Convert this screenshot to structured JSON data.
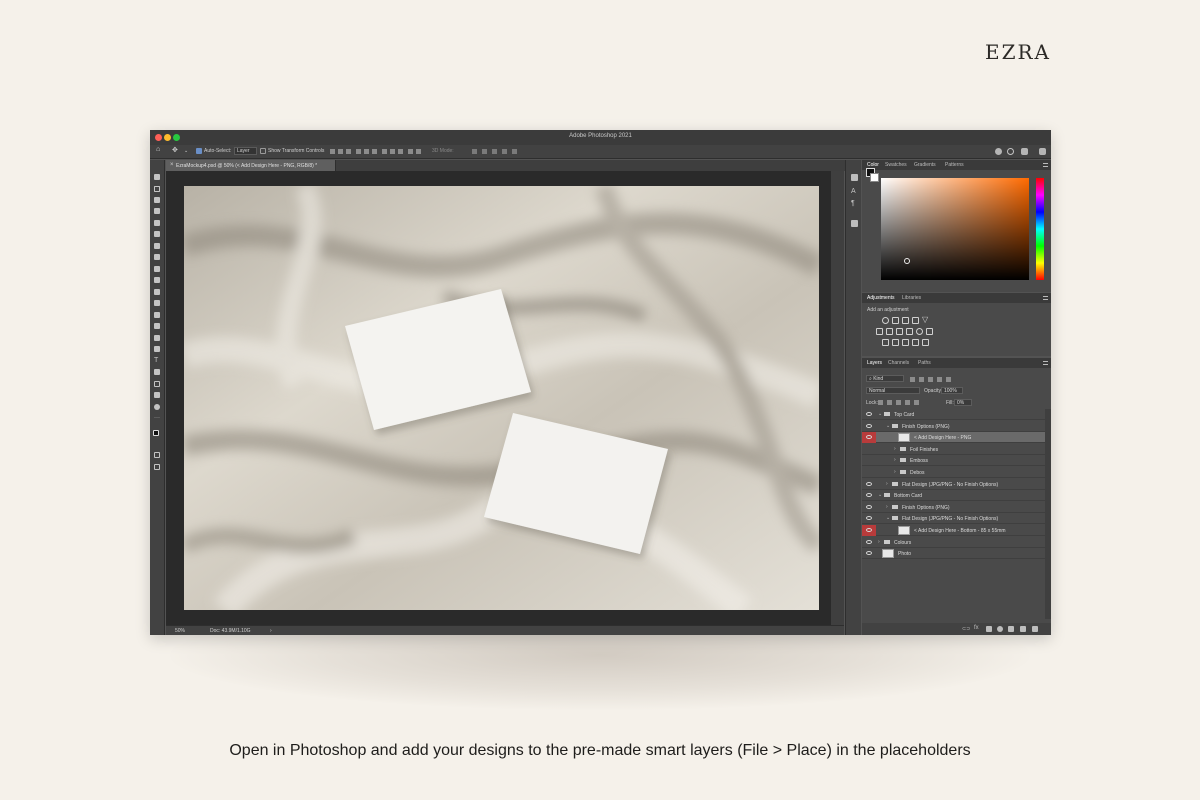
{
  "brand": "EZRA",
  "caption": "Open in Photoshop and add your designs to the pre-made smart layers (File > Place) in the placeholders",
  "app": {
    "window_title": "Adobe Photoshop 2021",
    "options_bar": {
      "auto_select": "Auto-Select:",
      "auto_select_target": "Layer",
      "show_transform": "Show Transform Controls",
      "mode_3d": "3D Mode:"
    },
    "document_tab": "EzraMockup4.psd @ 50% (< Add Design Here - PNG, RGB/8) *",
    "status": {
      "zoom": "50%",
      "doc": "Doc: 43.9M/1.10G"
    },
    "color_panel": {
      "tabs": [
        "Color",
        "Swatches",
        "Gradients",
        "Patterns"
      ]
    },
    "adjustments_panel": {
      "tabs": [
        "Adjustments",
        "Libraries"
      ],
      "hint": "Add an adjustment"
    },
    "layers_panel": {
      "tabs": [
        "Layers",
        "Channels",
        "Paths"
      ],
      "filter": "Kind",
      "blend_mode": "Normal",
      "opacity_label": "Opacity:",
      "opacity_value": "100%",
      "lock_label": "Lock:",
      "fill_label": "Fill:",
      "fill_value": "0%",
      "layers": [
        {
          "name": "Top Card",
          "indent": 0,
          "type": "group",
          "open": true,
          "eye": true,
          "red": false,
          "selected": false
        },
        {
          "name": "Finish Options (PNG)",
          "indent": 1,
          "type": "group",
          "open": true,
          "eye": true,
          "red": false,
          "selected": false
        },
        {
          "name": "< Add Design Here - PNG",
          "indent": 2,
          "type": "smart",
          "eye": true,
          "red": true,
          "selected": true
        },
        {
          "name": "Foil Finishes",
          "indent": 2,
          "type": "group",
          "open": false,
          "eye": false,
          "red": false,
          "selected": false
        },
        {
          "name": "Emboss",
          "indent": 2,
          "type": "group",
          "open": false,
          "eye": false,
          "red": false,
          "selected": false
        },
        {
          "name": "Debos",
          "indent": 2,
          "type": "group",
          "open": false,
          "eye": false,
          "red": false,
          "selected": false
        },
        {
          "name": "Flat Design (JPG/PNG - No Finish Options)",
          "indent": 1,
          "type": "group",
          "open": false,
          "eye": true,
          "red": false,
          "selected": false
        },
        {
          "name": "Bottom Card",
          "indent": 0,
          "type": "group",
          "open": true,
          "eye": true,
          "red": false,
          "selected": false
        },
        {
          "name": "Finish Options (PNG)",
          "indent": 1,
          "type": "group",
          "open": false,
          "eye": true,
          "red": false,
          "selected": false
        },
        {
          "name": "Flat Design (JPG/PNG - No Finish Options)",
          "indent": 1,
          "type": "group",
          "open": true,
          "eye": true,
          "red": false,
          "selected": false
        },
        {
          "name": "< Add Design Here - Bottom - 85 x 55mm",
          "indent": 2,
          "type": "smart",
          "eye": true,
          "red": true,
          "selected": false
        },
        {
          "name": "Colours",
          "indent": 0,
          "type": "group",
          "open": false,
          "eye": true,
          "red": false,
          "selected": false
        },
        {
          "name": "Photo",
          "indent": 0,
          "type": "image",
          "eye": true,
          "red": false,
          "selected": false
        }
      ]
    }
  }
}
